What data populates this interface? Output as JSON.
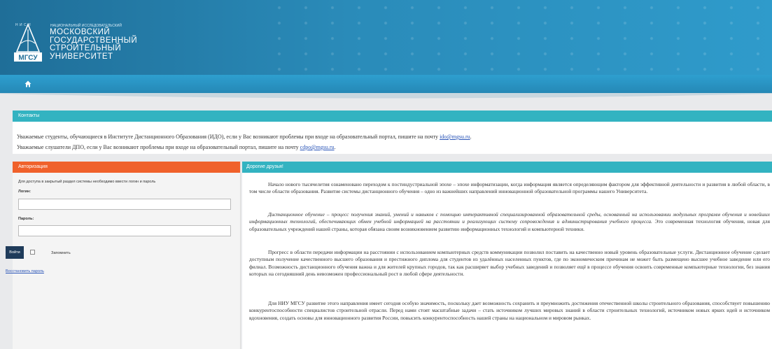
{
  "header": {
    "logo_abbr": "МГСУ",
    "logo_top_letters": "Н  И  С  И",
    "logo_subtitle": "НАЦИОНАЛЬНЫЙ ИССЛЕДОВАТЕЛЬСКИЙ",
    "logo_lines": [
      "МОСКОВСКИЙ",
      "ГОСУДАРСТВЕННЫЙ",
      "СТРОИТЕЛЬНЫЙ",
      "УНИВЕРСИТЕТ"
    ]
  },
  "navbar": {
    "home_icon": "home-icon"
  },
  "contacts": {
    "title": "Контакты",
    "line1_text": "Уважаемые студенты, обучающиеся в Институте Дистанционного Образования (ИДО), если у Вас возникают проблемы при входе на образовательный портал, пишите на почту ",
    "line1_email": "ido@mgsu.ru",
    "line1_end": ".",
    "line2_text": "Уважаемые слушатели ДПО, если у Вас возникают проблемы при входе на образовательный портал, пишите на почту  ",
    "line2_email": "cdpo@mgsu.ru",
    "line2_end": "."
  },
  "auth": {
    "title": "Авторизация",
    "hint": "Для доступа в закрытый раздел системы необходимо ввести логин и пароль",
    "login_label": "Логин:",
    "login_value": "",
    "password_label": "Пароль:",
    "password_value": "",
    "login_button": "Войти",
    "remember_label": "Запомнить",
    "restore_link": "Восстановить пароль"
  },
  "friends": {
    "title": "Дорогие друзья!",
    "paragraphs": [
      "Начало нового тысячелетия ознаменовано переходом к постиндустриальной эпохе – эпохе информатизации, когда информация является определяющим фактором для эффективной деятельности и развития в любой области, в том числе области образования. Развитие системы дистанционного обучения – одно из важнейших направлений инновационной образовательной программы нашего Университета.",
      "Дистанционное обучение – процесс получения знаний, умений и навыков с помощью интерактивной специализированной образовательной среды, основанный на использовании модульных программ обучения и новейших информационных технологий, обеспечивающих обмен учебной информацией на расстоянии и реализующих систему сопровождения и администрирования учебного процесса.",
      "Это современная технология обучения, новая для образовательных учреждений нашей страны, которая обязана своим возникновением развитию информационных технологий и компьютерной техники.",
      "Прогресс в области передачи информации на расстоянии с использованием компьютерных средств коммуникации позволил поставить на качественно новый уровень образовательные услуги. Дистанционное обучение сделает доступным получение качественного высшего образования и престижного диплома для студентов из удалённых населенных пунктов, где по экономическим причинам не может быть размещено высшее учебное заведение или его филиал. Возможность дистанционного обучения важна и для жителей крупных городов, так как расширяет выбор учебных заведений и позволяет ещё в процессе обучения освоить современные компьютерные технологии, без знания которых на сегодняшний день невозможен профессиональный рост в любой сфере деятельности.",
      "Для НИУ МГСУ развитие этого направления имеет сегодня особую значимость, поскольку дает возможность сохранить и преумножить достижения отечественной школы строительного образования, способствует повышению конкурентоспособности специалистов строительной отрасли. Перед нами стоят масштабные задачи – стать источником лучших мировых знаний в области строительных технологий, источником новых ярких идей и источником вдохновения, создать основы для инновационного развития России, повысить конкурентоспособность нашей страны на национальном и мировом рынках."
    ]
  },
  "colors": {
    "header": "#2a8bb9",
    "teal": "#33b3c1",
    "orange": "#f0612b",
    "button": "#1f3b5a",
    "link": "#2a55b8"
  }
}
